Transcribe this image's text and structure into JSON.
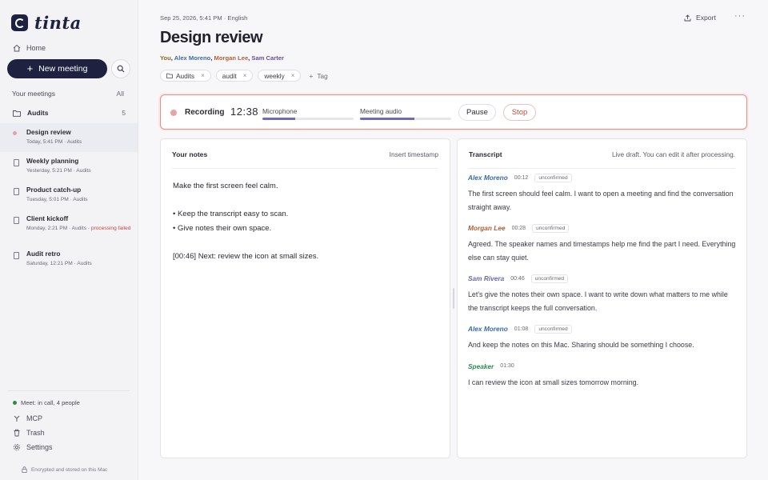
{
  "app": {
    "name": "tinta"
  },
  "sidebar": {
    "home_label": "Home",
    "new_meeting_label": "New meeting",
    "section_label": "Your meetings",
    "section_all": "All",
    "folder": {
      "label": "Audits",
      "count": "5"
    },
    "meetings": [
      {
        "title": "Design review",
        "sub": "Today, 5:41 PM · Audits",
        "active": true,
        "status": ""
      },
      {
        "title": "Weekly planning",
        "sub": "Yesterday, 5:21 PM · Audits",
        "status": ""
      },
      {
        "title": "Product catch-up",
        "sub": "Tuesday, 5:01 PM · Audits",
        "status": ""
      },
      {
        "title": "Client kickoff",
        "sub": "Monday, 2:21 PM · Audits · ",
        "status": "processing failed"
      },
      {
        "title": "Audit retro",
        "sub": "Saturday, 12:21 PM · Audits",
        "status": ""
      }
    ],
    "meet_status": "Meet: in call, 4 people",
    "mcp_label": "MCP",
    "trash_label": "Trash",
    "settings_label": "Settings",
    "encrypted_note": "Encrypted and stored on this Mac"
  },
  "header": {
    "meta": "Sep 25, 2026, 5:41 PM · English",
    "export_label": "Export",
    "more_label": "···",
    "title": "Design review",
    "participants": [
      {
        "name": "You",
        "color": "#8a6a1e"
      },
      {
        "name": "Alex Moreno",
        "color": "#3b6aa8"
      },
      {
        "name": "Morgan Lee",
        "color": "#b0603a"
      },
      {
        "name": "Sam Carter",
        "color": "#6a4aa0"
      }
    ],
    "tags": [
      "Audits",
      "audit",
      "weekly"
    ],
    "add_tag_label": "Tag"
  },
  "recording": {
    "label": "Recording",
    "time": "12:38",
    "microphone_label": "Microphone",
    "microphone_level": 0.36,
    "meeting_audio_label": "Meeting audio",
    "meeting_audio_level": 0.6,
    "pause_label": "Pause",
    "stop_label": "Stop"
  },
  "notes": {
    "heading": "Your notes",
    "insert_timestamp_label": "Insert timestamp",
    "line1": "Make the first screen feel calm.",
    "bullet1": "• Keep the transcript easy to scan.",
    "bullet2": "• Give notes their own space.",
    "line2": "[00:46] Next: review the icon at small sizes."
  },
  "transcript": {
    "heading": "Transcript",
    "status_note": "Live draft. You can edit it after processing.",
    "entries": [
      {
        "speaker": "Alex Moreno",
        "color": "#3b6aa8",
        "time": "00:12",
        "badge": "unconfirmed",
        "text": "The first screen should feel calm. I want to open a meeting and find the conversation straight away."
      },
      {
        "speaker": "Morgan Lee",
        "color": "#b0603a",
        "time": "00:28",
        "badge": "unconfirmed",
        "text": "Agreed. The speaker names and timestamps help me find the part I need. Everything else can stay quiet."
      },
      {
        "speaker": "Sam Rivera",
        "color": "#6a6ab0",
        "time": "00:46",
        "badge": "unconfirmed",
        "text": "Let's give the notes their own space. I want to write down what matters to me while the transcript keeps the full conversation."
      },
      {
        "speaker": "Alex Moreno",
        "color": "#3b6aa8",
        "time": "01:08",
        "badge": "unconfirmed",
        "text": "And keep the notes on this Mac. Sharing should be something I choose."
      },
      {
        "speaker": "Speaker",
        "color": "#2f8a4e",
        "time": "01:30",
        "badge": "",
        "text": "I can review the icon at small sizes tomorrow morning."
      }
    ]
  }
}
